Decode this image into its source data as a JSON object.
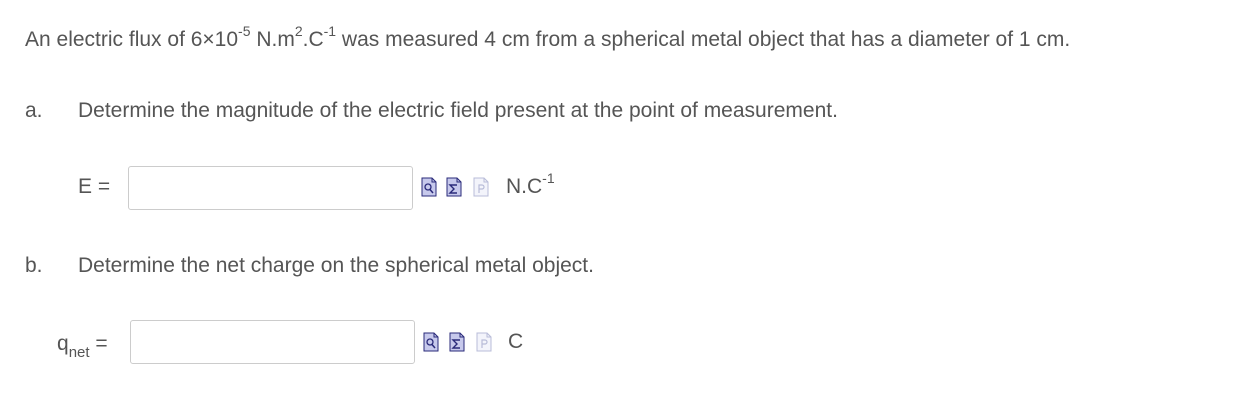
{
  "question": {
    "intro_prefix": "An electric flux of 6×10",
    "flux_exp": "-5",
    "intro_unit_a": " N.m",
    "flux_unit_exp2": "2",
    "intro_unit_b": ".C",
    "flux_unit_exp3": "-1",
    "intro_suffix": " was measured 4 cm from a spherical metal object that has a diameter of 1 cm."
  },
  "part_a": {
    "letter": "a.",
    "prompt": "Determine the magnitude of the electric field present at the point of measurement.",
    "var_label": "E =",
    "input_value": "",
    "unit": "N.C",
    "unit_exp": "-1"
  },
  "part_b": {
    "letter": "b.",
    "prompt": "Determine the net charge on the spherical metal object.",
    "var_main": "q",
    "var_sub": "net",
    "var_eq": " =",
    "input_value": "",
    "unit": "C"
  },
  "icons": [
    "preview-icon",
    "equation-icon",
    "paste-icon"
  ],
  "colors": {
    "text": "#555555",
    "icon_fill": "#c7c9ec",
    "icon_border": "#2a2a7a",
    "icon_disabled": "#b8bcd8",
    "input_border": "#cccccc"
  }
}
